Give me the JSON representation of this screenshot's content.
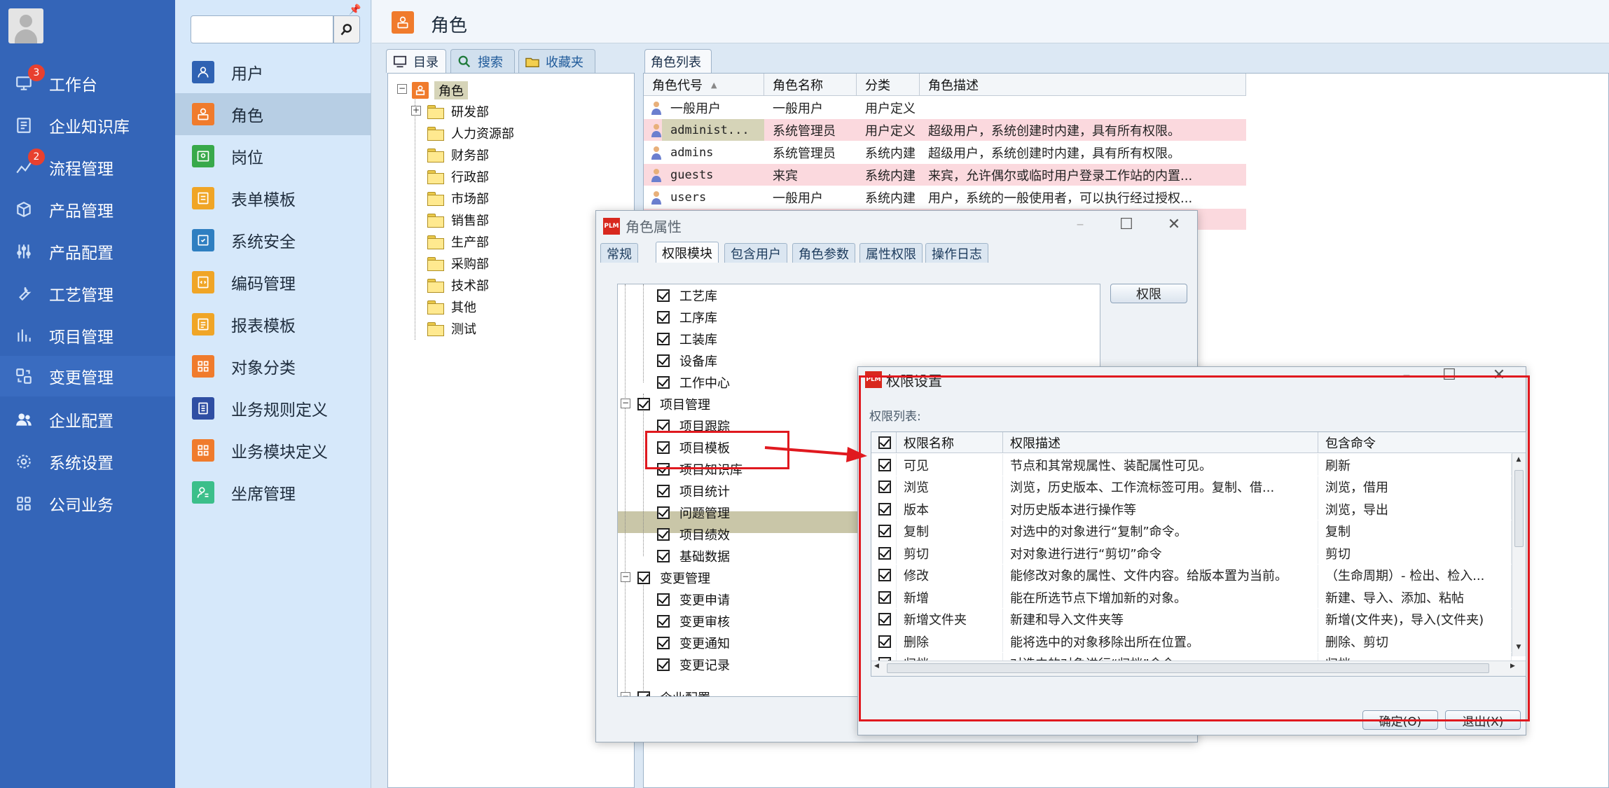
{
  "nav": {
    "items": [
      {
        "label": "工作台",
        "badge": "3",
        "icon": "monitor-icon"
      },
      {
        "label": "企业知识库",
        "badge": "",
        "icon": "book-icon"
      },
      {
        "label": "流程管理",
        "badge": "2",
        "icon": "flow-icon"
      },
      {
        "label": "产品管理",
        "badge": "",
        "icon": "cube-icon"
      },
      {
        "label": "产品配置",
        "badge": "",
        "icon": "sliders-icon"
      },
      {
        "label": "工艺管理",
        "badge": "",
        "icon": "wrench-icon"
      },
      {
        "label": "项目管理",
        "badge": "",
        "icon": "chart-icon"
      },
      {
        "label": "变更管理",
        "badge": "",
        "icon": "swap-icon"
      },
      {
        "label": "企业配置",
        "badge": "",
        "icon": "users-icon"
      },
      {
        "label": "系统设置",
        "badge": "",
        "icon": "gear-icon"
      },
      {
        "label": "公司业务",
        "badge": "",
        "icon": "grid-icon"
      }
    ]
  },
  "subnav": {
    "search_placeholder": "",
    "items": [
      {
        "label": "用户",
        "color": "#2f62b3"
      },
      {
        "label": "角色",
        "color": "#f07b2c"
      },
      {
        "label": "岗位",
        "color": "#38a94a"
      },
      {
        "label": "表单模板",
        "color": "#f0a526"
      },
      {
        "label": "系统安全",
        "color": "#2f7fc1"
      },
      {
        "label": "编码管理",
        "color": "#f0a526"
      },
      {
        "label": "报表模板",
        "color": "#f0a526"
      },
      {
        "label": "对象分类",
        "color": "#f07b2c"
      },
      {
        "label": "业务规则定义",
        "color": "#2f4ea3"
      },
      {
        "label": "业务模块定义",
        "color": "#f07b2c"
      },
      {
        "label": "坐席管理",
        "color": "#3bbf8a"
      }
    ]
  },
  "page": {
    "title": "角色"
  },
  "left_tabs": [
    "目录",
    "搜索",
    "收藏夹"
  ],
  "tree": {
    "root": "角色",
    "children": [
      "研发部",
      "人力资源部",
      "财务部",
      "行政部",
      "市场部",
      "销售部",
      "生产部",
      "采购部",
      "技术部",
      "其他",
      "测试"
    ]
  },
  "role_list": {
    "tab": "角色列表",
    "columns": [
      "角色代号",
      "角色名称",
      "分类",
      "角色描述"
    ],
    "rows": [
      {
        "code": "一般用户",
        "name": "一般用户",
        "category": "用户定义",
        "desc": ""
      },
      {
        "code": "administ...",
        "name": "系统管理员",
        "category": "用户定义",
        "desc": "超级用户，系统创建时内建，具有所有权限。"
      },
      {
        "code": "admins",
        "name": "系统管理员",
        "category": "系统内建",
        "desc": "超级用户，系统创建时内建，具有所有权限。"
      },
      {
        "code": "guests",
        "name": "来宾",
        "category": "系统内建",
        "desc": "来宾，允许偶尔或临时用户登录工作站的内置..."
      },
      {
        "code": "users",
        "name": "一般用户",
        "category": "系统内建",
        "desc": "用户，系统的一般使用者，可以执行经过授权..."
      }
    ]
  },
  "role_dialog": {
    "title": "角色属性",
    "tabs": [
      "常规",
      "权限模块",
      "包含用户",
      "角色参数",
      "属性权限",
      "操作日志"
    ],
    "rights_button": "权限",
    "nodes": [
      {
        "label": "工艺库",
        "level": 2
      },
      {
        "label": "工序库",
        "level": 2
      },
      {
        "label": "工装库",
        "level": 2
      },
      {
        "label": "设备库",
        "level": 2
      },
      {
        "label": "工作中心",
        "level": 2
      },
      {
        "label": "项目管理",
        "level": 1
      },
      {
        "label": "项目跟踪",
        "level": 2
      },
      {
        "label": "项目模板",
        "level": 2
      },
      {
        "label": "项目知识库",
        "level": 2
      },
      {
        "label": "项目统计",
        "level": 2
      },
      {
        "label": "问题管理",
        "level": 2
      },
      {
        "label": "项目绩效",
        "level": 2
      },
      {
        "label": "基础数据",
        "level": 2
      },
      {
        "label": "变更管理",
        "level": 1
      },
      {
        "label": "变更申请",
        "level": 2
      },
      {
        "label": "变更审核",
        "level": 2
      },
      {
        "label": "变更通知",
        "level": 2
      },
      {
        "label": "变更记录",
        "level": 2
      },
      {
        "label": "企业配置",
        "level": 1
      }
    ]
  },
  "perm_dialog": {
    "title": "权限设置",
    "list_label": "权限列表:",
    "columns": [
      "权限名称",
      "权限描述",
      "包含命令"
    ],
    "rows": [
      {
        "name": "可见",
        "desc": "节点和其常规属性、装配属性可见。",
        "cmd": "刷新"
      },
      {
        "name": "浏览",
        "desc": "浏览，历史版本、工作流标签可用。复制、借...",
        "cmd": "浏览，借用"
      },
      {
        "name": "版本",
        "desc": "对历史版本进行操作等",
        "cmd": "浏览，导出"
      },
      {
        "name": "复制",
        "desc": "对选中的对象进行“复制”命令。",
        "cmd": "复制"
      },
      {
        "name": "剪切",
        "desc": "对对象进行进行“剪切”命令",
        "cmd": "剪切"
      },
      {
        "name": "修改",
        "desc": "能修改对象的属性、文件内容。给版本置为当前。",
        "cmd": "（生命周期）- 检出、检入..."
      },
      {
        "name": "新增",
        "desc": "能在所选节点下增加新的对象。",
        "cmd": "新建、导入、添加、粘帖"
      },
      {
        "name": "新增文件夹",
        "desc": "新建和导入文件夹等",
        "cmd": "新增(文件夹)，导入(文件夹)"
      },
      {
        "name": "删除",
        "desc": "能将选中的对象移除出所在位置。",
        "cmd": "删除、剪切"
      },
      {
        "name": "归档",
        "desc": "对选中的对象进行“归档”命令。",
        "cmd": "归档"
      }
    ],
    "ok_button": "确定(O)",
    "exit_button": "退出(X)"
  },
  "colors": {
    "nav_bg": "#3465b8",
    "annotation_red": "#e0191f",
    "highlight_pink": "#fbd9de"
  }
}
